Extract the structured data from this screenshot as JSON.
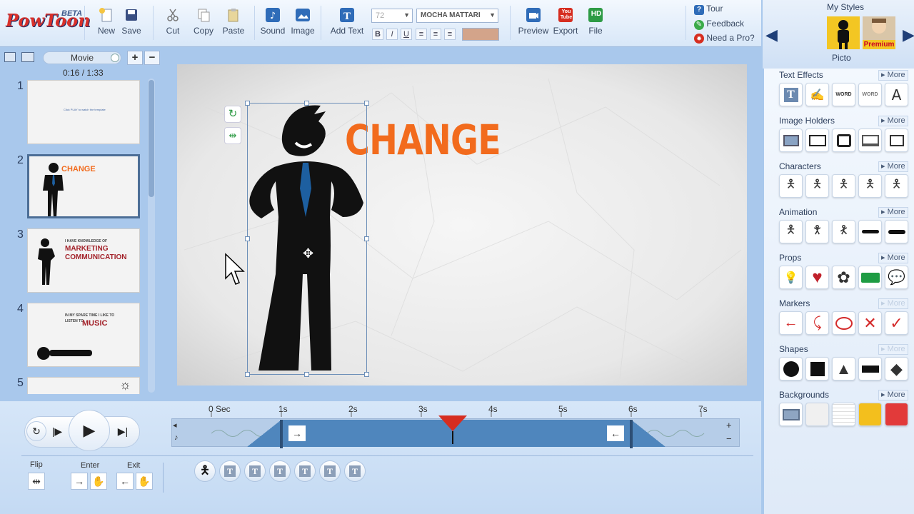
{
  "app": {
    "logo": "PowToon",
    "logo_tag": "BETA"
  },
  "toolbar": {
    "new": "New",
    "save": "Save",
    "cut": "Cut",
    "copy": "Copy",
    "paste": "Paste",
    "sound": "Sound",
    "image": "Image",
    "add_text": "Add Text",
    "font_size": "72",
    "font_family": "MOCHA MATTARI",
    "bold": "B",
    "italic": "I",
    "underline": "U",
    "text_color": "#d3a48a",
    "preview": "Preview",
    "export": "Export",
    "file": "File",
    "export_badge": "You Tube",
    "file_badge": "HD",
    "help": {
      "tour": "Tour",
      "feedback": "Feedback",
      "need_pro": "Need a Pro?"
    }
  },
  "my_styles": {
    "title": "My Styles",
    "selected": "Picto",
    "premium_badge": "Premium"
  },
  "library": {
    "sections": [
      {
        "title": "Text Effects",
        "more": "More"
      },
      {
        "title": "Image Holders",
        "more": "More"
      },
      {
        "title": "Characters",
        "more": "More"
      },
      {
        "title": "Animation",
        "more": "More"
      },
      {
        "title": "Props",
        "more": "More"
      },
      {
        "title": "Markers",
        "more": "More"
      },
      {
        "title": "Shapes",
        "more": "More"
      },
      {
        "title": "Backgrounds",
        "more": "More"
      }
    ],
    "text_effect_word": "WORD"
  },
  "slides": {
    "mode": "Movie",
    "time": "0:16 / 1:33",
    "items": [
      {
        "num": "1",
        "text": "Click PLAY to watch the template"
      },
      {
        "num": "2",
        "text": "CHANGE"
      },
      {
        "num": "3",
        "line1": "I HAVE KNOWLEDGE OF",
        "line2": "MARKETING",
        "line3": "COMMUNICATION"
      },
      {
        "num": "4",
        "line1": "IN MY SPARE TIME I LIKE TO",
        "line2": "LISTEN TO",
        "line3": "MUSIC"
      },
      {
        "num": "5"
      }
    ]
  },
  "stage": {
    "headline": "CHANGE",
    "headline_color": "#f26b1d"
  },
  "timeline": {
    "ticks": [
      "0 Sec",
      "1s",
      "2s",
      "3s",
      "4s",
      "5s",
      "6s",
      "7s"
    ],
    "enter_time_s": 1,
    "exit_time_s": 6,
    "playhead_s": 3.45
  },
  "effects": {
    "flip": "Flip",
    "enter": "Enter",
    "exit": "Exit"
  }
}
